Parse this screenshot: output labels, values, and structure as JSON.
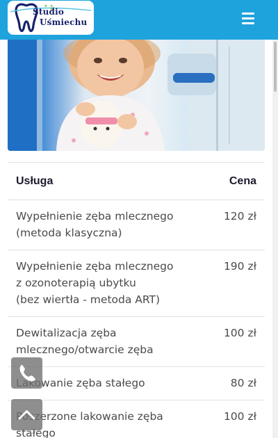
{
  "header": {
    "logo": {
      "line1": "Studio",
      "line2": "Uśmiechu"
    },
    "menu_icon": "hamburger-menu-icon",
    "colors": {
      "header_bg": "#1fa3dd",
      "logo_text": "#16226b"
    }
  },
  "hero": {
    "image": "smiling toddler holding a plush tooth toy in dental office"
  },
  "price_table": {
    "headers": {
      "service": "Usługa",
      "price": "Cena"
    },
    "rows": [
      {
        "service": [
          "Wypełnienie zęba mlecznego",
          "(metoda klasyczna)"
        ],
        "price": "120 zł"
      },
      {
        "service": [
          "Wypełnienie zęba mlecznego",
          "z ozonoterapią ubytku",
          "(bez wiertła - metoda ART)"
        ],
        "price": "190 zł"
      },
      {
        "service": [
          "Dewitalizacja zęba",
          "mlecznego/otwarcie zęba"
        ],
        "price": "100 zł"
      },
      {
        "service": [
          "Lakowanie zęba stałego"
        ],
        "price": "80 zł"
      },
      {
        "service": [
          "Poszerzone lakowanie zęba",
          "stałego"
        ],
        "price": "100 zł"
      }
    ]
  },
  "floating_buttons": {
    "call_icon": "phone-icon",
    "top_icon": "chevron-up-icon"
  }
}
